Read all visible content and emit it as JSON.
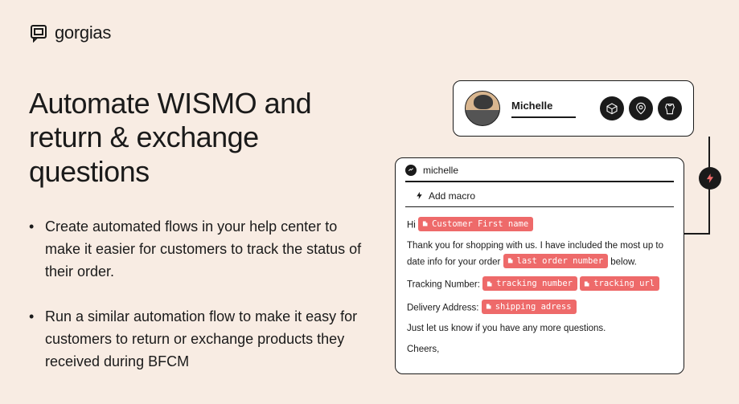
{
  "brand": {
    "name": "gorgias"
  },
  "headline": "Automate WISMO and return & exchange questions",
  "bullets": [
    "Create automated flows in your help center to make it easier for customers to track the status of their order.",
    "Run a similar automation flow to make it easy for customers to return or exchange products they received during BFCM"
  ],
  "profile": {
    "name": "Michelle"
  },
  "macro": {
    "channel_label": "michelle",
    "add_macro": "Add macro",
    "greeting": "Hi",
    "tag_first_name": "Customer First name",
    "line1_a": "Thank you for shopping with us. I have included the most up to date info for your order",
    "tag_last_order": "last order number",
    "line1_b": "below.",
    "tracking_label": "Tracking Number:",
    "tag_tracking_number": "tracking number",
    "tag_tracking_url": "tracking url",
    "delivery_label": "Delivery Address:",
    "tag_shipping": "shipping adress",
    "closing_a": "Just let us know if you have any more questions.",
    "closing_b": "Cheers,"
  }
}
